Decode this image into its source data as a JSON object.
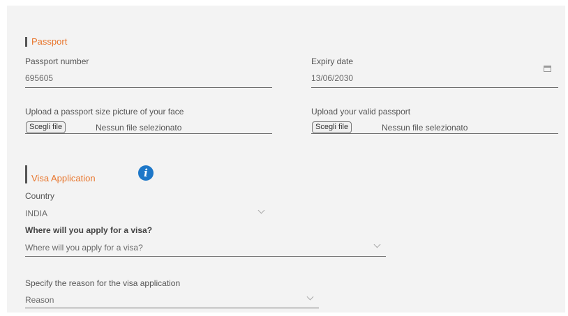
{
  "passport": {
    "section_title": "Passport",
    "number_label": "Passport number",
    "number_value": "695605",
    "expiry_label": "Expiry date",
    "expiry_value": "13/06/2030",
    "face_upload_label": "Upload a passport size picture of your face",
    "passport_upload_label": "Upload your valid passport",
    "choose_file_label": "Scegli file",
    "no_file_text": "Nessun file selezionato"
  },
  "visa": {
    "section_title": "Visa Application",
    "country_label": "Country",
    "country_value": "INDIA",
    "apply_label": "Where will you apply for a visa?",
    "apply_placeholder": "Where will you apply for a visa?",
    "reason_label": "Specify the reason for the visa application",
    "reason_placeholder": "Reason"
  },
  "colors": {
    "accent": "#e8762d",
    "info": "#1d77c8"
  }
}
